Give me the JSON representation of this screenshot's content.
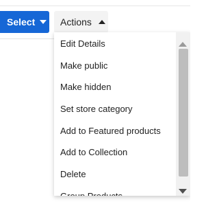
{
  "toolbar": {
    "select_label": "Select",
    "actions_label": "Actions"
  },
  "menu": {
    "items": [
      "Edit Details",
      "Make public",
      "Make hidden",
      "Set store category",
      "Add to Featured products",
      "Add to Collection",
      "Delete",
      "Group Products"
    ]
  },
  "background": {
    "partial_char": "◦"
  },
  "colors": {
    "select_button_bg": "#1667d6",
    "actions_button_bg": "#f3f3f3",
    "scrollbar_thumb": "#bdbdbd"
  },
  "icons": {
    "select_caret": "caret-down-icon",
    "actions_caret": "caret-up-icon",
    "scroll_up": "scroll-up-arrow-icon",
    "scroll_down": "scroll-down-arrow-icon"
  }
}
